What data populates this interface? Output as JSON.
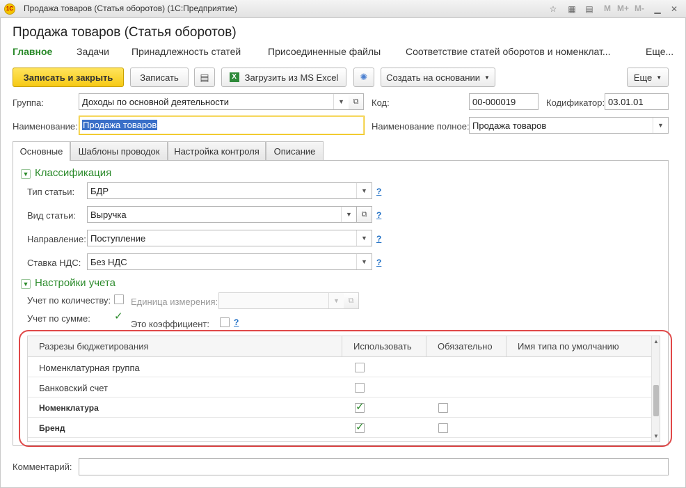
{
  "window": {
    "title": "Продажа товаров (Статья оборотов)  (1С:Предприятие)",
    "logo_text": "1С",
    "memory_buttons": [
      "M",
      "M+",
      "M-"
    ]
  },
  "form": {
    "title": "Продажа товаров (Статья оборотов)"
  },
  "nav": {
    "links": [
      "Главное",
      "Задачи",
      "Принадлежность статей",
      "Присоединенные файлы",
      "Соответствие статей оборотов и номенклат...",
      "Еще..."
    ]
  },
  "toolbar": {
    "save_close": "Записать и закрыть",
    "save": "Записать",
    "load_excel": "Загрузить из MS Excel",
    "create_based": "Создать на основании",
    "more": "Еще"
  },
  "header_fields": {
    "group_label": "Группа:",
    "group_value": "Доходы по основной деятельности",
    "code_label": "Код:",
    "code_value": "00-000019",
    "codifier_label": "Кодификатор:",
    "codifier_value": "03.01.01",
    "name_label": "Наименование:",
    "name_value": "Продажа товаров",
    "full_name_label": "Наименование полное:",
    "full_name_value": "Продажа товаров"
  },
  "tabs": [
    "Основные",
    "Шаблоны проводок",
    "Настройка контроля",
    "Описание"
  ],
  "classification": {
    "title": "Классификация",
    "type_label": "Тип статьи:",
    "type_value": "БДР",
    "kind_label": "Вид статьи:",
    "kind_value": "Выручка",
    "direction_label": "Направление:",
    "direction_value": "Поступление",
    "vat_label": "Ставка НДС:",
    "vat_value": "Без НДС",
    "help": "?"
  },
  "accounting": {
    "title": "Настройки учета",
    "by_qty_label": "Учет по количеству:",
    "unit_label": "Единица измерения:",
    "unit_value": "",
    "by_sum_label": "Учет по сумме:",
    "coef_label": "Это коэффициент:",
    "help": "?"
  },
  "table": {
    "headers": [
      "Разрезы бюджетирования",
      "Использовать",
      "Обязательно",
      "Имя типа по умолчанию"
    ],
    "rows": [
      {
        "name": "Номенклатурная группа",
        "bold": false,
        "use": false,
        "required": null
      },
      {
        "name": "Банковский счет",
        "bold": false,
        "use": false,
        "required": null
      },
      {
        "name": "Номенклатура",
        "bold": true,
        "use": true,
        "required": false
      },
      {
        "name": "Бренд",
        "bold": true,
        "use": true,
        "required": false
      }
    ]
  },
  "comment": {
    "label": "Комментарий:",
    "value": ""
  }
}
